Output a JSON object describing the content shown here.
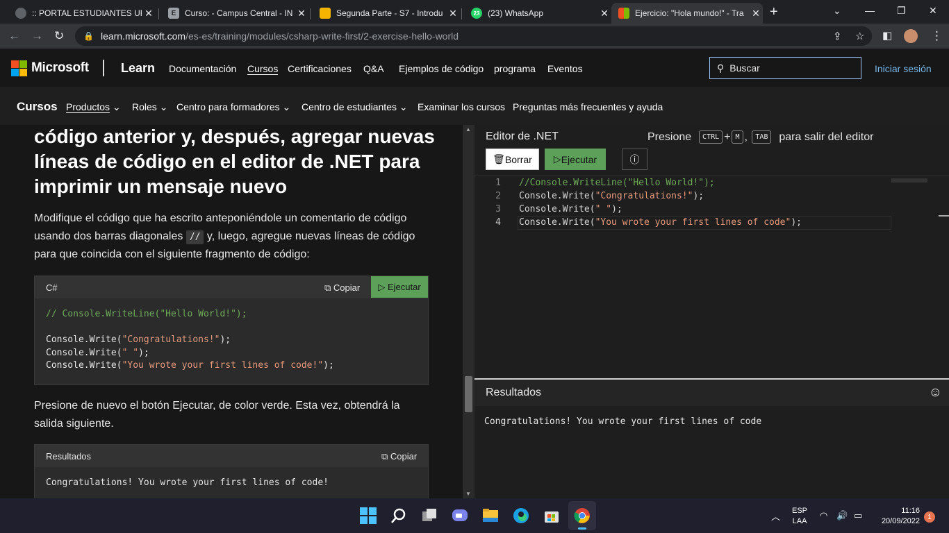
{
  "browser": {
    "tabs": [
      {
        "title": ":: PORTAL ESTUDIANTES URL",
        "icon": "globe-icon"
      },
      {
        "title": "Curso: - Campus Central - IN",
        "icon": "e-icon"
      },
      {
        "title": "Segunda Parte - S7 - Introdu",
        "icon": "slides-icon"
      },
      {
        "title": "(23) WhatsApp",
        "icon": "whatsapp-icon",
        "badge": "23"
      },
      {
        "title": "Ejercicio: \"Hola mundo!\" - Tra",
        "icon": "microsoft-icon"
      }
    ],
    "url_domain": "learn.microsoft.com",
    "url_path": "/es-es/training/modules/csharp-write-first/2-exercise-hello-world"
  },
  "header": {
    "brand": "Microsoft",
    "product": "Learn",
    "nav": [
      "Documentación",
      "Cursos",
      "Certificaciones",
      "Q&A",
      "Ejemplos de código",
      "programa",
      "Eventos"
    ],
    "search_placeholder": "Buscar",
    "signin": "Iniciar sesión"
  },
  "subheader": {
    "title": "Cursos",
    "nav": [
      {
        "label": "Productos",
        "dropdown": true
      },
      {
        "label": "Roles",
        "dropdown": true
      },
      {
        "label": "Centro para formadores",
        "dropdown": true
      },
      {
        "label": "Centro de estudiantes",
        "dropdown": true
      },
      {
        "label": "Examinar los cursos",
        "dropdown": false
      },
      {
        "label": "Preguntas más frecuentes y ayuda",
        "dropdown": false
      }
    ]
  },
  "article": {
    "heading": "código anterior y, después, agregar nuevas líneas de código en el editor de .NET para imprimir un mensaje nuevo",
    "para1_a": "Modifique el código que ha escrito anteponiéndole un comentario de código usando dos barras diagonales ",
    "para1_code": "//",
    "para1_b": " y, luego, agregue nuevas líneas de código para que coincida con el siguiente fragmento de código:",
    "code_block": {
      "lang": "C#",
      "copy": "Copiar",
      "run": "Ejecutar",
      "comment": "// Console.WriteLine(\"Hello World!\");",
      "lines": [
        {
          "pre": "Console.Write(",
          "str": "\"Congratulations!\"",
          "post": ");"
        },
        {
          "pre": "Console.Write(",
          "str": "\" \"",
          "post": ");"
        },
        {
          "pre": "Console.Write(",
          "str": "\"You wrote your first lines of code!\"",
          "post": ");"
        }
      ]
    },
    "para2": "Presione de nuevo el botón Ejecutar, de color verde. Esta vez, obtendrá la salida siguiente.",
    "result_block": {
      "title": "Resultados",
      "copy": "Copiar",
      "output": "Congratulations! You wrote your first lines of code!"
    }
  },
  "editor": {
    "title": "Editor de .NET",
    "hint_pre": "Presione",
    "key_ctrl": "CTRL",
    "key_plus": "+",
    "key_m": "M",
    "key_tab": "TAB",
    "hint_post": "para salir del editor",
    "clear": "Borrar",
    "run": "Ejecutar",
    "lines": [
      {
        "n": "1",
        "comment": "//Console.WriteLine(\"Hello World!\");"
      },
      {
        "n": "2",
        "pre": "Console.Write(",
        "str": "\"Congratulations!\"",
        "post": ");"
      },
      {
        "n": "3",
        "pre": "Console.Write(",
        "str": "\" \"",
        "post": ");"
      },
      {
        "n": "4",
        "pre": "Console.Write(",
        "str": "\"You wrote your first lines of code\"",
        "post": ");"
      }
    ],
    "results_title": "Resultados",
    "output": "Congratulations! You wrote your first lines of code"
  },
  "taskbar": {
    "lang1": "ESP",
    "lang2": "LAA",
    "time": "11:16",
    "date": "20/09/2022",
    "notifications": "1"
  },
  "colors": {
    "accent_green": "#5da05a",
    "link_blue": "#75b6e7",
    "comment_green": "#6fab59",
    "string_orange": "#e69a7c"
  }
}
